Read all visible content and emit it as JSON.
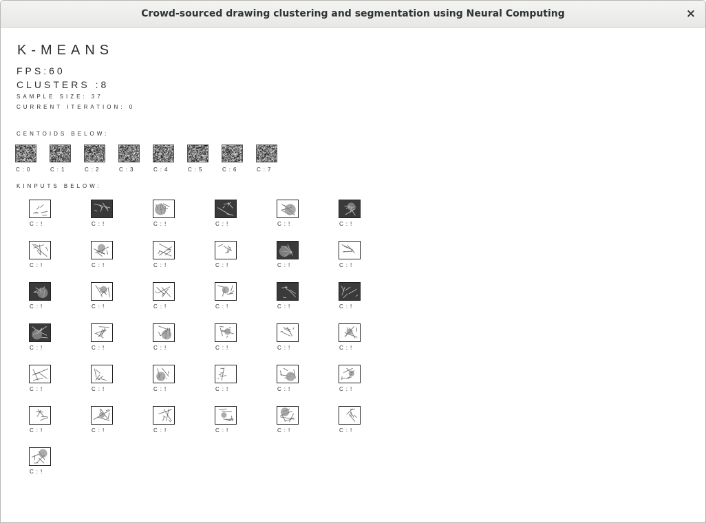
{
  "window": {
    "title": "Crowd-sourced drawing clustering and segmentation using Neural Computing",
    "close_glyph": "×"
  },
  "header": {
    "algorithm": "K-MEANS",
    "fps": "FPS:60",
    "clusters": "CLUSTERS :8",
    "sample_size": "SAMPLE SIZE: 37",
    "current_iteration": "CURRENT ITERATION: 0"
  },
  "centroids": {
    "heading": "CENTOIDS BELOW:",
    "labels": [
      "C:0",
      "C:1",
      "C:2",
      "C:3",
      "C:4",
      "C:5",
      "C:6",
      "C:7"
    ]
  },
  "inputs": {
    "heading": "KINPUTS BELOW:",
    "label": "C:!",
    "count": 37,
    "dark": [
      false,
      true,
      false,
      true,
      false,
      true,
      false,
      false,
      false,
      false,
      true,
      false,
      true,
      false,
      false,
      false,
      true,
      true,
      true,
      false,
      false,
      false,
      false,
      false,
      false,
      false,
      false,
      false,
      false,
      false,
      false,
      false,
      false,
      false,
      false,
      false,
      false
    ]
  }
}
